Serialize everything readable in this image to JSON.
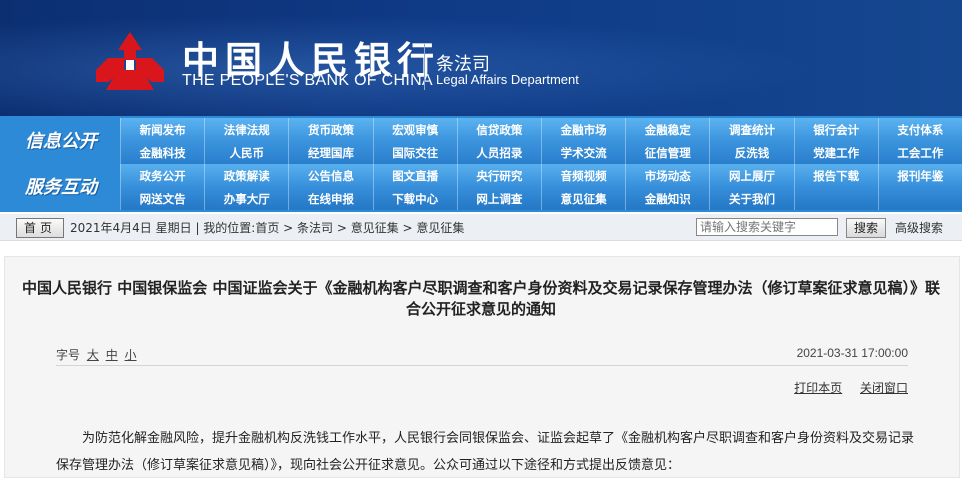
{
  "header": {
    "title_cn": "中国人民银行",
    "title_en": "THE PEOPLE'S BANK OF CHINA",
    "dept_cn": "条法司",
    "dept_en": "Legal Affairs Department",
    "brand_color": "#0f3a86",
    "emblem_color": "#d8161c"
  },
  "nav": {
    "section_a": "信息公开",
    "section_b": "服务互动",
    "rows": [
      [
        "新闻发布",
        "法律法规",
        "货币政策",
        "宏观审慎",
        "信贷政策",
        "金融市场",
        "金融稳定",
        "调查统计",
        "银行会计",
        "支付体系"
      ],
      [
        "金融科技",
        "人民币",
        "经理国库",
        "国际交往",
        "人员招录",
        "学术交流",
        "征信管理",
        "反洗钱",
        "党建工作",
        "工会工作"
      ],
      [
        "政务公开",
        "政策解读",
        "公告信息",
        "图文直播",
        "央行研究",
        "音频视频",
        "市场动态",
        "网上展厅",
        "报告下载",
        "报刊年鉴"
      ],
      [
        "网送文告",
        "办事大厅",
        "在线申报",
        "下载中心",
        "网上调查",
        "意见征集",
        "金融知识",
        "关于我们",
        "",
        ""
      ]
    ]
  },
  "crumb": {
    "home_label": "首页",
    "text": "2021年4月4日 星期日 | 我的位置:首页 > 条法司 > 意见征集 > 意见征集",
    "search_placeholder": "请输入搜索关键字",
    "search_label": "搜索",
    "advanced_label": "高级搜索"
  },
  "article": {
    "title": "中国人民银行 中国银保监会 中国证监会关于《金融机构客户尽职调查和客户身份资料及交易记录保存管理办法（修订草案征求意见稿）》联合公开征求意见的通知",
    "font_label": "字号",
    "font_large": "大",
    "font_medium": "中",
    "font_small": "小",
    "date": "2021-03-31 17:00:00",
    "print_label": "打印本页",
    "close_label": "关闭窗口",
    "body": "为防范化解金融风险，提升金融机构反洗钱工作水平，人民银行会同银保监会、证监会起草了《金融机构客户尽职调查和客户身份资料及交易记录保存管理办法（修订草案征求意见稿）》，现向社会公开征求意见。公众可通过以下途径和方式提出反馈意见："
  }
}
